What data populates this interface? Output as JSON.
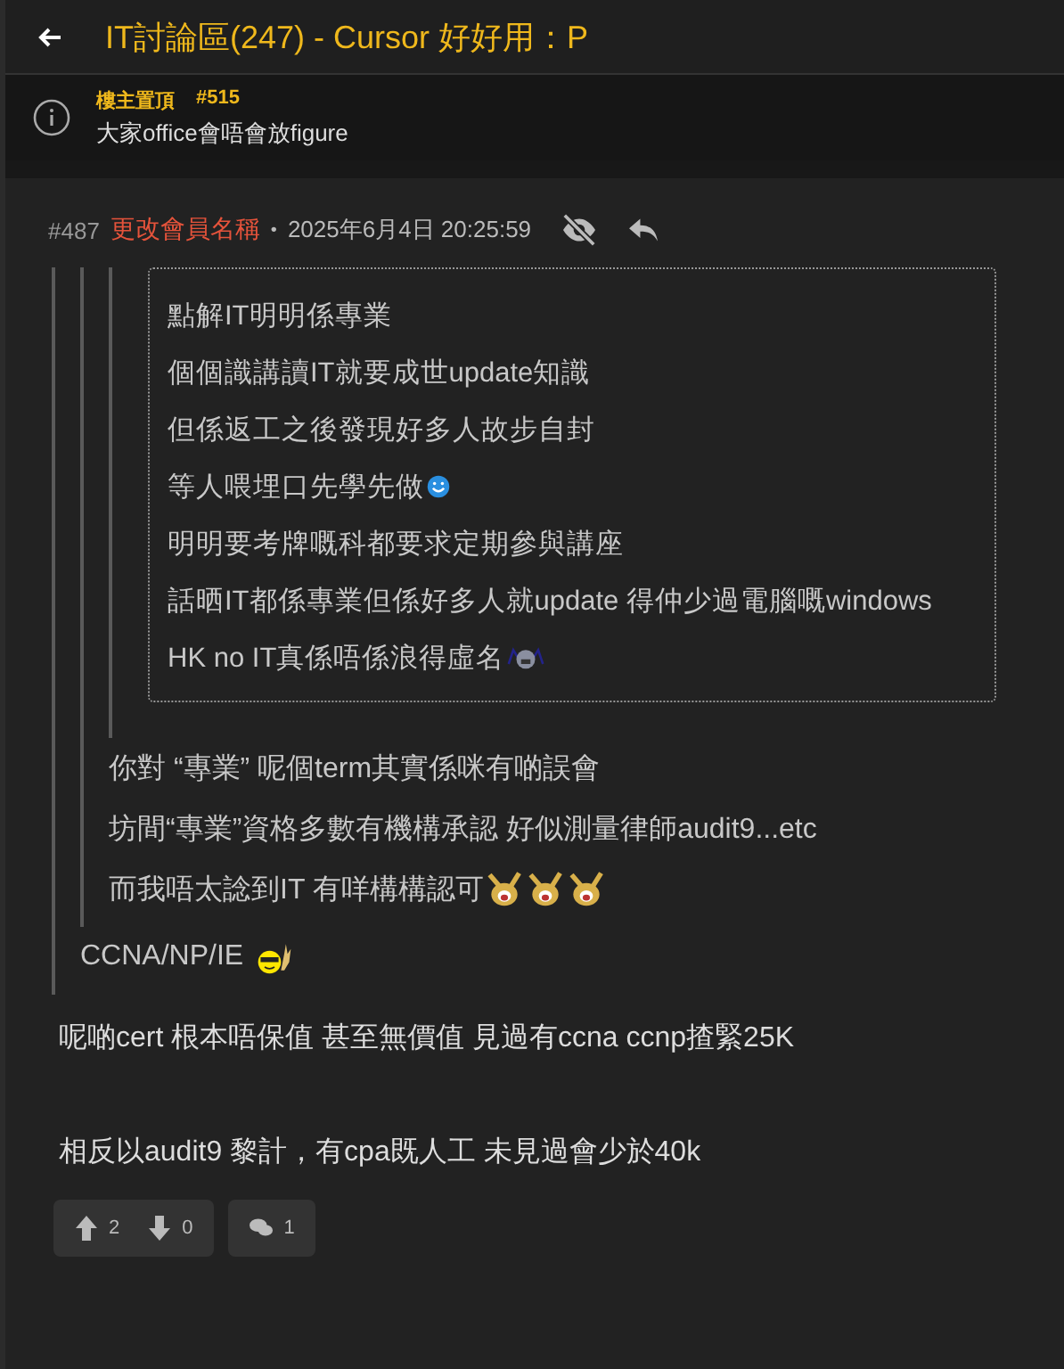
{
  "header": {
    "title": "IT討論區(247) - Cursor 好好用：P"
  },
  "pinned": {
    "label": "樓主置頂",
    "number": "#515",
    "text": "大家office會唔會放figure"
  },
  "post": {
    "number": "#487",
    "author": "更改會員名稱",
    "separator": "•",
    "time": "2025年6月4日 20:25:59",
    "quote": {
      "kind": "bar",
      "lines": [
        {
          "text": "CCNA/NP/IE",
          "emoticons": [
            {
              "kind": "cool"
            }
          ]
        }
      ],
      "quote": {
        "kind": "bar",
        "lines": [
          {
            "text": "你對 “專業” 呢個term其實係咪有啲誤會"
          },
          {
            "text": "坊間“專業”資格多數有機構承認 好似測量律師audit9...etc"
          },
          {
            "text": "而我唔太諗到IT 有咩構構認可",
            "emoticons": [
              {
                "kind": "cheer"
              },
              {
                "kind": "cheer"
              },
              {
                "kind": "cheer"
              }
            ]
          }
        ],
        "quote": {
          "kind": "bar",
          "quote": {
            "kind": "boxed",
            "lines": [
              {
                "text": "點解IT明明係專業"
              },
              {
                "text": "個個識講讀IT就要成世update知識"
              },
              {
                "text": "但係返工之後發現好多人故步自封"
              },
              {
                "text": "等人喂埋口先學先做",
                "emoticons": [
                  {
                    "kind": "smile"
                  }
                ]
              },
              {
                "text": "明明要考牌嘅科都要求定期參與講座"
              },
              {
                "text": "話晒IT都係專業但係好多人就update 得仲少過電腦嘅windows"
              },
              {
                "text": "HK no IT真係唔係浪得虛名",
                "emoticons": [
                  {
                    "kind": "shock"
                  }
                ]
              }
            ]
          }
        }
      }
    },
    "body": [
      "呢啲cert 根本唔保值 甚至無價值 見過有ccna ccnp揸緊25K",
      "相反以audit9 黎計，有cpa既人工 未見過會少於40k"
    ],
    "upvotes": "2",
    "downvotes": "0",
    "replies": "1"
  }
}
